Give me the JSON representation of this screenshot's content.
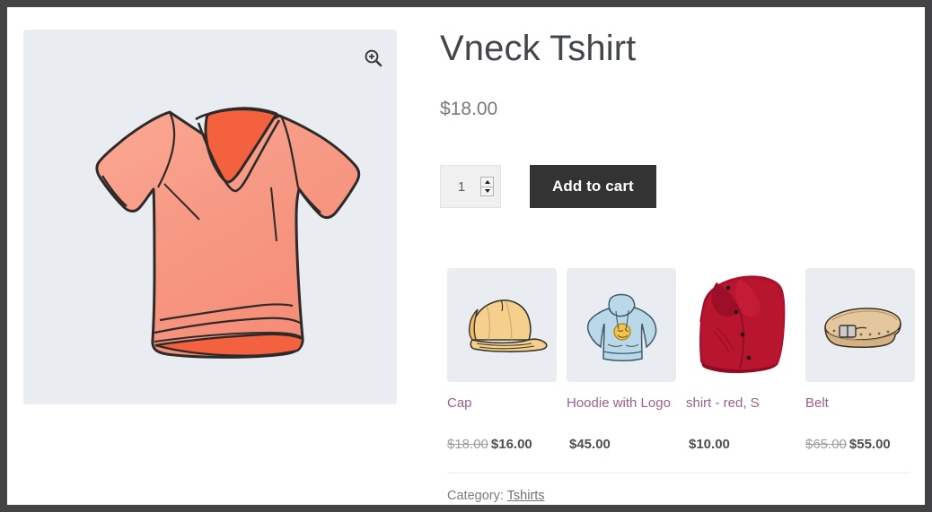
{
  "product": {
    "title": "Vneck Tshirt",
    "price": "$18.00",
    "image_alt": "vneck-tshirt-illustration",
    "zoom_icon": "magnifier-plus-icon"
  },
  "cart_form": {
    "quantity_value": "1",
    "add_to_cart_label": "Add to cart"
  },
  "upsells": [
    {
      "name": "Cap",
      "image_alt": "cap-illustration",
      "price_was": "$18.00",
      "price_now": "$16.00",
      "on_sale": true
    },
    {
      "name": "Hoodie with Logo",
      "image_alt": "hoodie-with-logo-illustration",
      "price_was": "",
      "price_now": "$45.00",
      "on_sale": false
    },
    {
      "name": "shirt - red, S",
      "image_alt": "red-folded-shirt-photo",
      "price_was": "",
      "price_now": "$10.00",
      "on_sale": false
    },
    {
      "name": "Belt",
      "image_alt": "belt-illustration",
      "price_was": "$65.00",
      "price_now": "$55.00",
      "on_sale": true
    }
  ],
  "meta": {
    "category_label": "Category:",
    "category_value": "Tshirts"
  },
  "colors": {
    "page_border": "#434244",
    "thumb_background": "#e9edf1",
    "button_background": "#333333",
    "link_purple": "#9b5f8e",
    "tshirt_fill": "#f79a85",
    "tshirt_accent": "#f4613f"
  }
}
